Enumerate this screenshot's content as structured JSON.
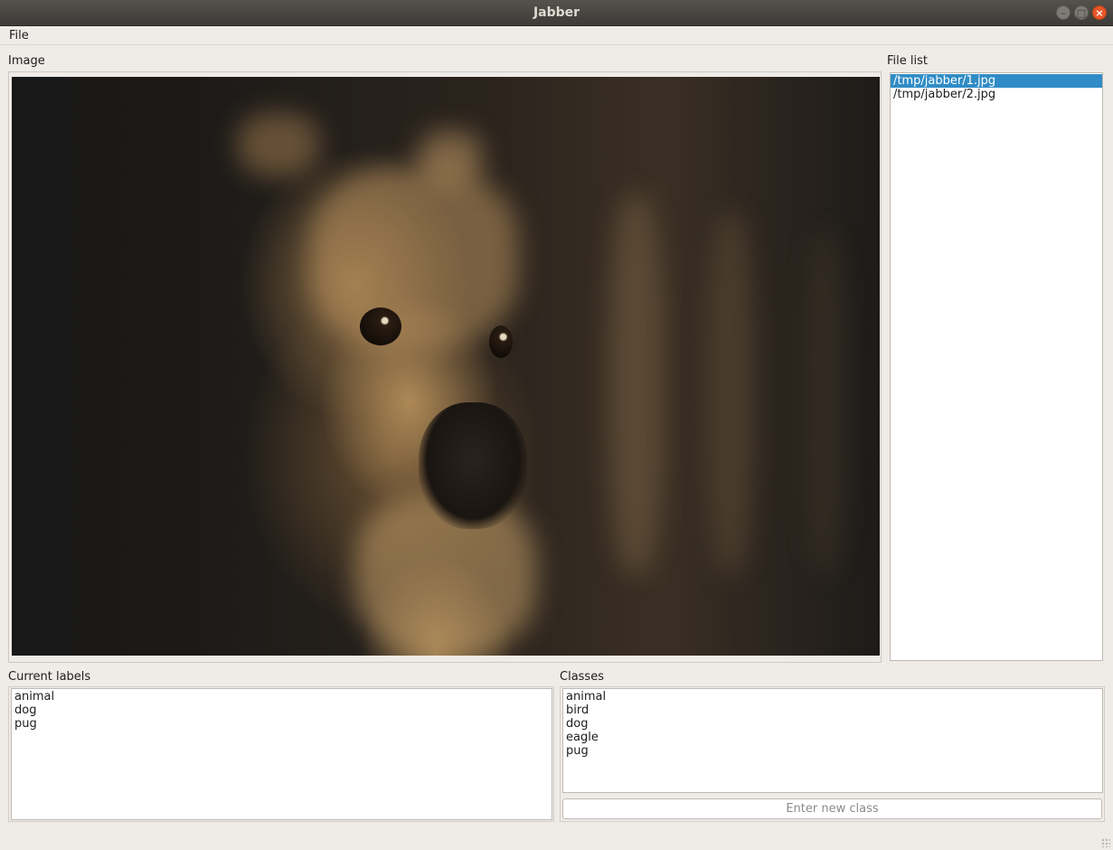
{
  "window": {
    "title": "Jabber"
  },
  "menubar": {
    "items": [
      "File"
    ]
  },
  "image_panel": {
    "label": "Image"
  },
  "file_list": {
    "label": "File list",
    "items": [
      "/tmp/jabber/1.jpg",
      "/tmp/jabber/2.jpg"
    ],
    "selected_index": 0
  },
  "current_labels": {
    "label": "Current labels",
    "items": [
      "animal",
      "dog",
      "pug"
    ]
  },
  "classes": {
    "label": "Classes",
    "items": [
      "animal",
      "bird",
      "dog",
      "eagle",
      "pug"
    ],
    "new_class_placeholder": "Enter new class",
    "new_class_value": ""
  },
  "colors": {
    "selection": "#308cc6",
    "close_button": "#e9562a",
    "window_bg": "#efebe7"
  }
}
